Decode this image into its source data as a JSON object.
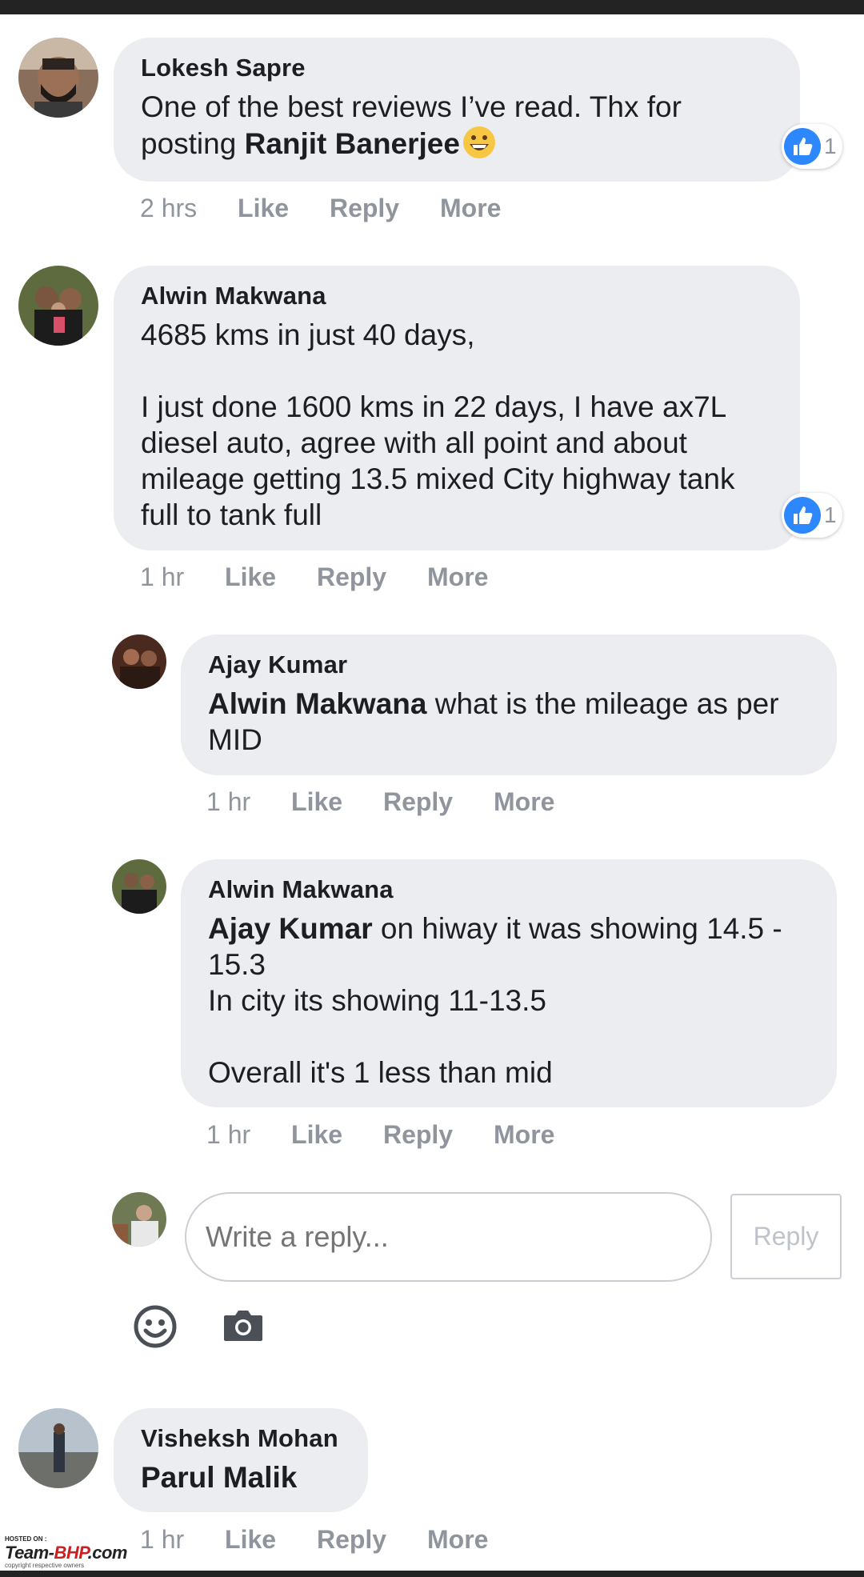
{
  "comments": [
    {
      "author": "Lokesh Sapre",
      "text": "One of the best reviews I’ve read. Thx for posting ",
      "mention_end": "Ranjit Banerjee",
      "time": "2 hrs",
      "reactions": "1"
    },
    {
      "author": "Alwin Makwana",
      "text": "4685 kms in just 40 days,\n\nI just done 1600 kms in 22 days, I have ax7L diesel auto, agree with all point and about mileage getting 13.5 mixed City highway tank full to tank full",
      "time": "1 hr",
      "reactions": "1"
    },
    {
      "author": "Ajay Kumar",
      "mention": "Alwin Makwana",
      "text": " what is the mileage as per MID",
      "time": "1 hr"
    },
    {
      "author": "Alwin Makwana",
      "mention": "Ajay Kumar",
      "text": " on hiway it was showing 14.5 - 15.3\nIn city its showing 11-13.5\n\nOverall it's 1 less than mid",
      "time": "1 hr"
    },
    {
      "author": "Visheksh Mohan",
      "mention": "Parul Malik",
      "time": "1 hr"
    }
  ],
  "actions": {
    "like": "Like",
    "reply": "Reply",
    "more": "More"
  },
  "reply_box": {
    "placeholder": "Write a reply...",
    "button": "Reply"
  },
  "watermark": {
    "hosted": "HOSTED ON :",
    "logo_a": "Team-",
    "logo_b": "BHP",
    "logo_c": ".com",
    "copyright": "copyright respective owners"
  },
  "colors": {
    "bubble": "#ebedf0",
    "meta": "#90949c",
    "like_blue": "#2d88ff"
  },
  "icons": [
    "thumbs-up-icon",
    "emoji-icon",
    "camera-icon",
    "grinning-face-icon"
  ]
}
